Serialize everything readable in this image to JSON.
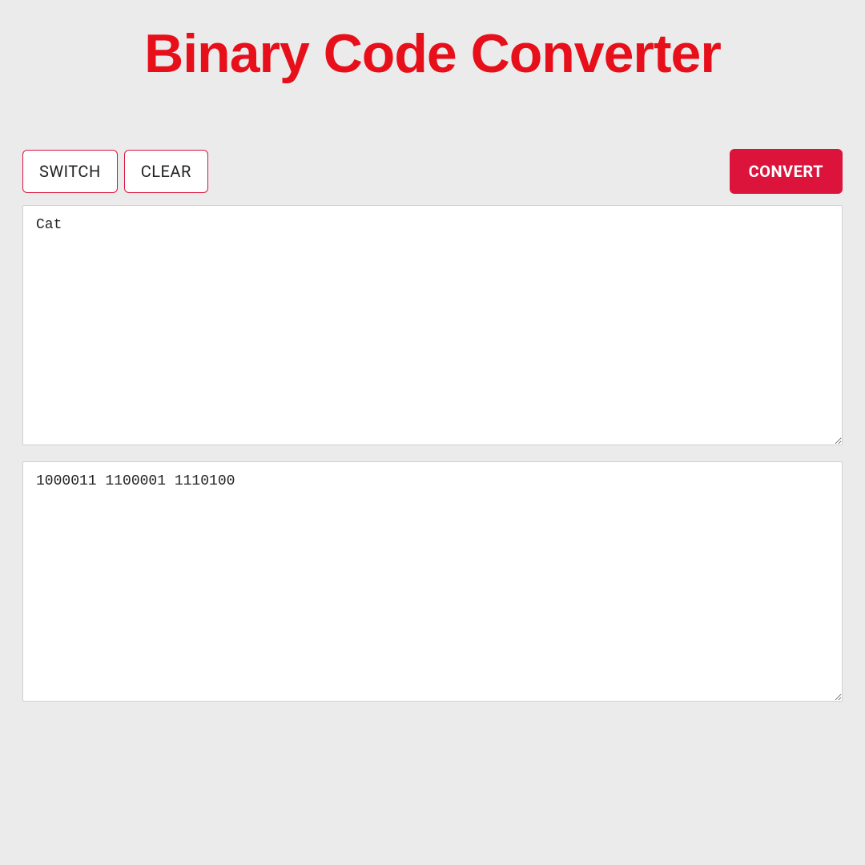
{
  "header": {
    "title": "Binary Code Converter"
  },
  "toolbar": {
    "switch_label": "SWITCH",
    "clear_label": "CLEAR",
    "convert_label": "CONVERT"
  },
  "inputs": {
    "source_value": "Cat",
    "output_value": "1000011 1100001 1110100"
  }
}
